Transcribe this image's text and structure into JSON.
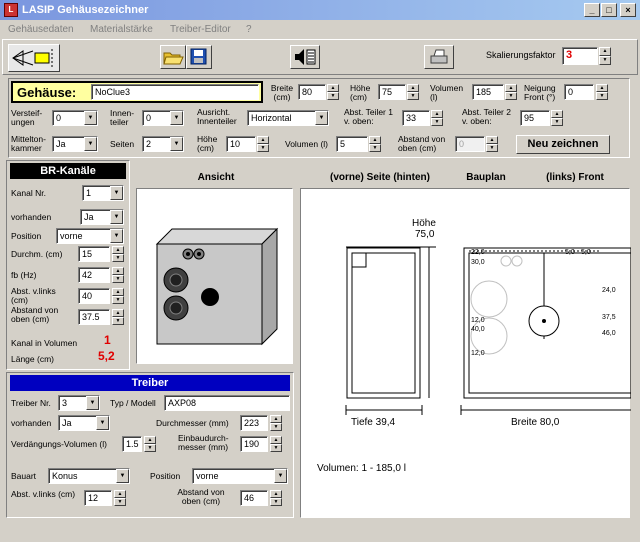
{
  "window": {
    "title": "LASIP  Gehäusezeichner",
    "app_icon": "L"
  },
  "menu": [
    "Gehäusedaten",
    "Materialstärke",
    "Treiber-Editor",
    "?"
  ],
  "toolbar": {
    "scale_label": "Skalierungsfaktor",
    "scale_value": "3"
  },
  "gehaeuse": {
    "label": "Gehäuse:",
    "name": "NoClue3",
    "breite_label": "Breite (cm)",
    "breite": "80",
    "hoehe_label": "Höhe (cm)",
    "hoehe": "75",
    "volumen_label": "Volumen (l)",
    "volumen": "185",
    "neigung_label": "Neigung Front (°)",
    "neigung": "0"
  },
  "row2": {
    "versteif_label": "Versteif- ungen",
    "versteif": "0",
    "innen_label": "Innen- teiler",
    "innen": "0",
    "ausricht_label": "Ausricht. Innenteiler",
    "ausricht": "Horizontal",
    "abst1_label": "Abst. Teiler 1 v. oben:",
    "abst1": "33",
    "abst2_label": "Abst. Teiler 2 v. oben:",
    "abst2": "95"
  },
  "row3": {
    "mittel_label": "Mittelton- kammer",
    "mittel": "Ja",
    "seiten_label": "Seiten",
    "seiten": "2",
    "hoehe_label": "Höhe (cm)",
    "hoehe": "10",
    "vol_label": "Volumen (l)",
    "vol": "5",
    "abstand_label": "Abstand von oben (cm)",
    "abstand": "0",
    "neu_button": "Neu zeichnen"
  },
  "br": {
    "header": "BR-Kanäle",
    "kanal_label": "Kanal Nr.",
    "kanal": "1",
    "vorh_label": "vorhanden",
    "vorh": "Ja",
    "pos_label": "Position",
    "pos": "vorne",
    "durchm_label": "Durchm. (cm)",
    "durchm": "15",
    "fb_label": "fb (Hz)",
    "fb": "42",
    "abstl_label": "Abst. v.links (cm)",
    "abstl": "40",
    "absto_label": "Abstand von oben (cm)",
    "absto": "37.5",
    "kvol_label": "Kanal in Volumen",
    "kvol": "1",
    "laenge_label": "Länge (cm)",
    "laenge": "5,2"
  },
  "treiber": {
    "header": "Treiber",
    "nr_label": "Treiber Nr.",
    "nr": "3",
    "typ_label": "Typ / Modell",
    "typ": "AXP08",
    "vorh_label": "vorhanden",
    "vorh": "Ja",
    "durchm_label": "Durchmesser (mm)",
    "durchm": "223",
    "verd_label": "Verdängungs-Volumen (l)",
    "verd": "1.5",
    "einbau_label": "Einbaudurch- messer (mm)",
    "einbau": "190",
    "bauart_label": "Bauart",
    "bauart": "Konus",
    "pos_label": "Position",
    "pos": "vorne",
    "abstl_label": "Abst. v.links (cm)",
    "abstl": "12",
    "absto_label": "Abstand von oben (cm)",
    "absto": "46"
  },
  "views": {
    "ansicht": "Ansicht",
    "seite": "(vorne) Seite (hinten)",
    "bauplan": "Bauplan",
    "front": "(links) Front"
  },
  "drawing": {
    "hoehe_label": "Höhe",
    "hoehe_val": "75,0",
    "tiefe": "Tiefe 39,4",
    "breite": "Breite 80,0",
    "volumen": "Volumen:  1 - 185,0  l",
    "d22": "22,0",
    "d30": "30,0",
    "d12a": "12,0",
    "d40": "40,0",
    "d12b": "12,0",
    "d5a": "5,0",
    "d5b": "5,0",
    "d24": "24,0",
    "d375": "37,5",
    "d46": "46,0"
  }
}
